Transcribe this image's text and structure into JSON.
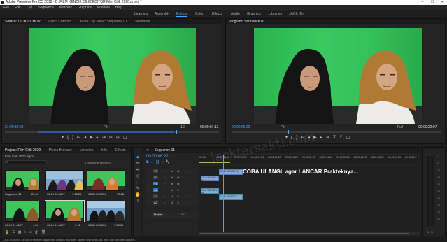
{
  "titlebar": {
    "title": "Adobe Premiere Pro CC 2018 - D:\\FILM KENDIK CILIK\\EDITOR\\Film Cilik 2020.prproj *",
    "controls": [
      "–",
      "☐",
      "✕"
    ]
  },
  "menu": [
    "File",
    "Edit",
    "Clip",
    "Sequence",
    "Markers",
    "Graphics",
    "Window",
    "Help"
  ],
  "workspaces": [
    {
      "label": "Learning",
      "active": false
    },
    {
      "label": "Assembly",
      "active": false
    },
    {
      "label": "Editing",
      "active": true
    },
    {
      "label": "Color",
      "active": false
    },
    {
      "label": "Effects",
      "active": false
    },
    {
      "label": "Audio",
      "active": false
    },
    {
      "label": "Graphics",
      "active": false
    },
    {
      "label": "Libraries",
      "active": false
    },
    {
      "label": "JACK ID",
      "active": false
    }
  ],
  "source_monitor": {
    "tabs": [
      "Source: CILIK 01.MOV",
      "Effect Controls",
      "Audio Clip Mixer: Sequence 01",
      "Metadata"
    ],
    "timecode_left": "21:29:34:03",
    "fit": "Fit",
    "zoom": "1/2",
    "timecode_right": "00:00:07:12"
  },
  "program_monitor": {
    "tab": "Program: Sequence 01",
    "timecode_left": "00:00:06:22",
    "fit": "Fit",
    "zoom": "Full",
    "timecode_right": "00:00:22:07"
  },
  "project": {
    "tabs": [
      "Project: Film Cilik 2020",
      "Media Browser",
      "Libraries",
      "Info",
      "Effects"
    ],
    "file_name": "Film Cilik 2020.prproj",
    "selection_info": "1 of 6 items selected",
    "items": [
      {
        "name": "Sequence 01",
        "duration": "22:07"
      },
      {
        "name": "CILIK 02.MOV",
        "duration": "1:16:21"
      },
      {
        "name": "CILIK 03.MOV",
        "duration": "12:08"
      },
      {
        "name": "CILIK 01.MOV",
        "duration": "4:24"
      },
      {
        "name": "CILIK 01.MOV",
        "duration": "7:12"
      },
      {
        "name": "CILIK 05.MOV",
        "duration": "1:58:19"
      }
    ]
  },
  "timeline": {
    "tab": "Sequence 01",
    "timecode": "00:00:06:22",
    "ruler": [
      "00:00",
      "00:00:04:23",
      "00:00:09:23",
      "00:00:14:23",
      "00:00:19:23",
      "00:00:24:23",
      "00:00:29:23",
      "00:00:34:23",
      "00:00:39:23",
      "00:00:44:23",
      "00:00:49:23",
      "00:00:54:23",
      "00:00:59:2"
    ],
    "tracks": [
      {
        "id": "V3",
        "label": "V3"
      },
      {
        "id": "V2",
        "label": "V2"
      },
      {
        "id": "V1",
        "label": "V1"
      },
      {
        "id": "A1",
        "label": "A1"
      },
      {
        "id": "A2",
        "label": "A2"
      },
      {
        "id": "A3",
        "label": "A3"
      },
      {
        "id": "Master",
        "label": "Master",
        "value": "0.0"
      }
    ],
    "clips": [
      {
        "track": "V2",
        "label": "CILIK 01.MOV [V]"
      },
      {
        "track": "V1",
        "label": "CILIK 01.MOV [V]"
      },
      {
        "track": "A1",
        "label": "CILIK 01.MOV [A]"
      },
      {
        "track": "A2",
        "label": "CILIK 01.MOV"
      }
    ],
    "overlay_text": "COBA ULANGI, agar LANCAR Prakteknya..."
  },
  "audio_meter": {
    "scale": [
      "0",
      "-6",
      "-12",
      "-18",
      "-24",
      "-30",
      "-36",
      "-42",
      "-48",
      "-54"
    ],
    "bottom_labels": [
      "S",
      "S"
    ]
  },
  "status_bar": "Click to select, or click in empty space and drag to marquee select. Use Shift, Alt, and Ctrl for other options.",
  "watermark": "jacktersakti.com"
}
